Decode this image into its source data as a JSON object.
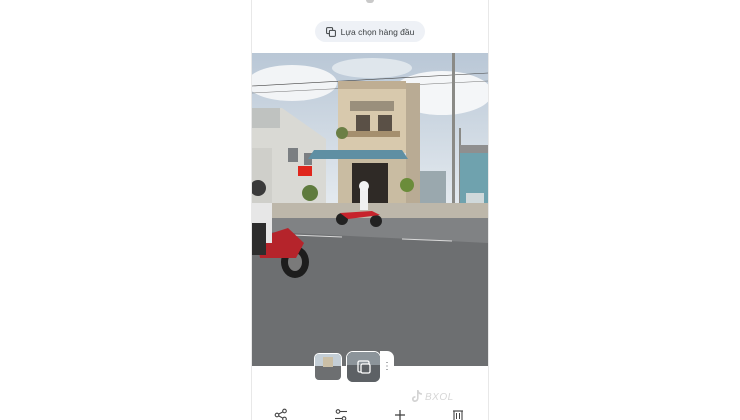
{
  "top_chip": {
    "label": "Lựa chọn hàng đầu",
    "icon": "copy-stack-icon"
  },
  "photo": {
    "description_icon": "street-photo",
    "flag_color": "#e0261c"
  },
  "thumbnail_strip": {
    "more_icon": "more-vert-icon",
    "more_label": "⋮"
  },
  "watermark": {
    "text": "BXOL",
    "icon": "tiktok-icon"
  },
  "bottom_bar": {
    "icons": [
      "share-icon",
      "edit-sliders-icon",
      "add-icon",
      "delete-icon"
    ]
  },
  "colors": {
    "chip_bg": "#eef1f6",
    "text": "#3c4043"
  }
}
